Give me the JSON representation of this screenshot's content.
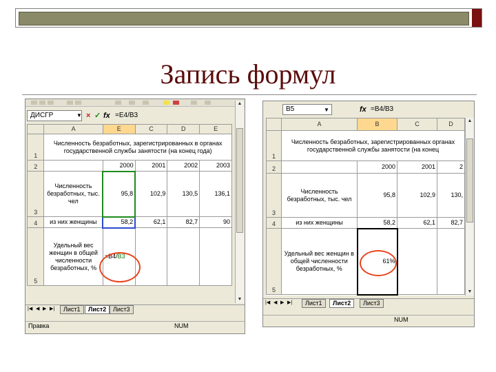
{
  "slide": {
    "title": "Запись формул"
  },
  "colors": {
    "title": "#5a0c0c",
    "oval": "#e8431c",
    "reference_green": "#0b7a0b"
  },
  "shot1": {
    "name_box": "ДИСГР",
    "icons": {
      "cancel": "×",
      "confirm": "✓",
      "fx": "fx"
    },
    "formula": "=E4/B3",
    "columns": [
      "A",
      "E",
      "C",
      "D",
      "E"
    ],
    "rows": [
      {
        "num": "1",
        "cells": [
          "Численность безработных, зарегистрированных в органах государственной службы занятости (на конец года)"
        ]
      },
      {
        "num": "2",
        "cells": [
          "",
          "2000",
          "2001",
          "2002",
          "2003"
        ]
      },
      {
        "num": "3",
        "cells": [
          "Численность безработных, тыс. чел",
          "95,8",
          "102,9",
          "130,5",
          "136,1"
        ]
      },
      {
        "num": "4",
        "cells": [
          "из них женщины",
          "58,2",
          "62,1",
          "82,7",
          "90"
        ]
      },
      {
        "num": "5",
        "cells": [
          "Удельный вес женщин в общей численности безработных, %",
          "=B4/B3",
          "",
          "",
          ""
        ]
      }
    ],
    "cell_formula_prefix": "=B4/",
    "cell_formula_ref": "B3",
    "sheets": [
      "Лист1",
      "Лист2",
      "Лист3"
    ],
    "active_sheet": "Лист2",
    "status_left": "Правка",
    "status_mid": "NUM"
  },
  "shot2": {
    "name_box": "B5",
    "fx": "fx",
    "formula": "=B4/B3",
    "columns": [
      "A",
      "B",
      "C",
      "D"
    ],
    "rows": [
      {
        "num": "1",
        "cells": [
          "Численность безработных, зарегистрированных органах государственной службы занятости (на конец"
        ]
      },
      {
        "num": "2",
        "cells": [
          "",
          "2000",
          "2001",
          "2"
        ]
      },
      {
        "num": "3",
        "cells": [
          "Численность безработных, тыс. чел",
          "95,8",
          "102,9",
          "130,"
        ]
      },
      {
        "num": "4",
        "cells": [
          "из них женщины",
          "58,2",
          "62,1",
          "82,7"
        ]
      },
      {
        "num": "5",
        "cells": [
          "Удельный вес женщин в общей численности безработных, %",
          "61%",
          "",
          ""
        ]
      }
    ],
    "sheets": [
      "Лист1",
      "Лист2",
      "Лист3"
    ],
    "active_sheet": "Лист2",
    "status_mid": "NUM"
  }
}
